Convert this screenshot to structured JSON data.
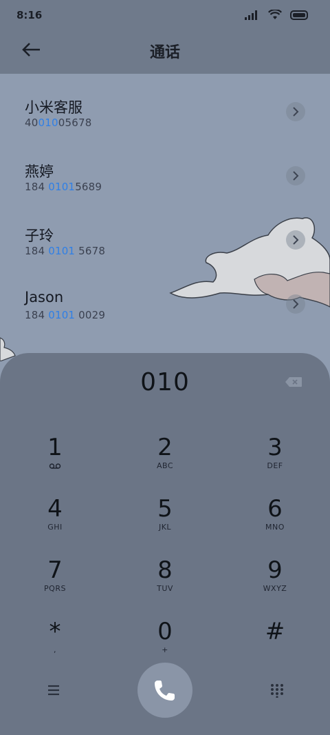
{
  "status": {
    "time": "8:16"
  },
  "header": {
    "title": "通话"
  },
  "contacts": [
    {
      "name": "小米客服",
      "pre": "40",
      "match": "010",
      "post": "05678"
    },
    {
      "name": "燕婷",
      "pre": "184 ",
      "match": "0101",
      "post": "5689"
    },
    {
      "name": "子玲",
      "pre": "184 ",
      "match": "0101",
      "post": " 5678"
    },
    {
      "name": "Jason",
      "pre": "184 ",
      "match": "0101",
      "post": " 0029"
    }
  ],
  "dialpad": {
    "number": "010",
    "keys": [
      {
        "digit": "1",
        "letters": ""
      },
      {
        "digit": "2",
        "letters": "ABC"
      },
      {
        "digit": "3",
        "letters": "DEF"
      },
      {
        "digit": "4",
        "letters": "GHI"
      },
      {
        "digit": "5",
        "letters": "JKL"
      },
      {
        "digit": "6",
        "letters": "MNO"
      },
      {
        "digit": "7",
        "letters": "PQRS"
      },
      {
        "digit": "8",
        "letters": "TUV"
      },
      {
        "digit": "9",
        "letters": "WXYZ"
      },
      {
        "digit": "*",
        "letters": ","
      },
      {
        "digit": "0",
        "letters": "+"
      },
      {
        "digit": "#",
        "letters": ""
      }
    ]
  },
  "icons": {
    "back": "back-arrow-icon",
    "chevron": "chevron-right-icon",
    "backspace": "backspace-icon",
    "voicemail": "voicemail-icon",
    "menu": "menu-icon",
    "call": "phone-icon",
    "keypad": "keypad-grid-icon"
  },
  "colors": {
    "highlight": "#2f7fe6",
    "dialpad_bg": "#6b7586",
    "call_button": "#8a95a7"
  }
}
